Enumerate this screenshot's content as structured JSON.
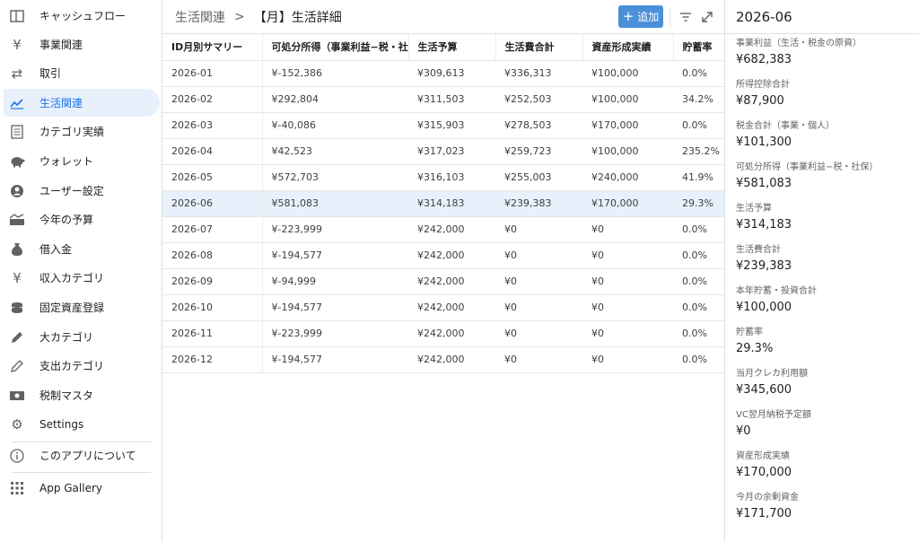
{
  "sidebar": {
    "items": [
      {
        "label": "キャッシュフロー",
        "icon": "sidebar-panel-icon"
      },
      {
        "label": "事業関連",
        "icon": "yen-icon"
      },
      {
        "label": "取引",
        "icon": "swap-icon"
      },
      {
        "label": "生活関連",
        "icon": "trending-icon",
        "active": true
      },
      {
        "label": "カテゴリ実績",
        "icon": "list-document-icon"
      },
      {
        "label": "ウォレット",
        "icon": "piggy-bank-icon"
      },
      {
        "label": "ユーザー設定",
        "icon": "account-circle-icon"
      },
      {
        "label": "今年の予算",
        "icon": "budget-icon"
      },
      {
        "label": "借入金",
        "icon": "money-bag-icon"
      },
      {
        "label": "収入カテゴリ",
        "icon": "yen-icon"
      },
      {
        "label": "固定資産登録",
        "icon": "coins-stack-icon"
      },
      {
        "label": "大カテゴリ",
        "icon": "pen-icon"
      },
      {
        "label": "支出カテゴリ",
        "icon": "pencil-outline-icon"
      },
      {
        "label": "税制マスタ",
        "icon": "banknote-icon"
      },
      {
        "label": "Settings",
        "icon": "gear-icon"
      },
      {
        "label": "このアプリについて",
        "icon": "info-icon"
      },
      {
        "label": "App Gallery",
        "icon": "grid-icon"
      }
    ]
  },
  "header": {
    "breadcrumb_parent": "生活関連",
    "breadcrumb_sep": ">",
    "title": "【月】生活詳細",
    "add_label": "追加",
    "add_icon": "plus-icon",
    "filter_icon": "filter-icon",
    "expand_icon": "expand-icon",
    "accent_color": "#4a90d9"
  },
  "table": {
    "columns": [
      "ID月別サマリー",
      "可処分所得（事業利益−税・社保）",
      "生活予算",
      "生活費合計",
      "資産形成実績",
      "貯蓄率"
    ],
    "selected_row": "2026-06",
    "rows": [
      [
        "2026-01",
        "¥-152,386",
        "¥309,613",
        "¥336,313",
        "¥100,000",
        "0.0%"
      ],
      [
        "2026-02",
        "¥292,804",
        "¥311,503",
        "¥252,503",
        "¥100,000",
        "34.2%"
      ],
      [
        "2026-03",
        "¥-40,086",
        "¥315,903",
        "¥278,503",
        "¥170,000",
        "0.0%"
      ],
      [
        "2026-04",
        "¥42,523",
        "¥317,023",
        "¥259,723",
        "¥100,000",
        "235.2%"
      ],
      [
        "2026-05",
        "¥572,703",
        "¥316,103",
        "¥255,003",
        "¥240,000",
        "41.9%"
      ],
      [
        "2026-06",
        "¥581,083",
        "¥314,183",
        "¥239,383",
        "¥170,000",
        "29.3%"
      ],
      [
        "2026-07",
        "¥-223,999",
        "¥242,000",
        "¥0",
        "¥0",
        "0.0%"
      ],
      [
        "2026-08",
        "¥-194,577",
        "¥242,000",
        "¥0",
        "¥0",
        "0.0%"
      ],
      [
        "2026-09",
        "¥-94,999",
        "¥242,000",
        "¥0",
        "¥0",
        "0.0%"
      ],
      [
        "2026-10",
        "¥-194,577",
        "¥242,000",
        "¥0",
        "¥0",
        "0.0%"
      ],
      [
        "2026-11",
        "¥-223,999",
        "¥242,000",
        "¥0",
        "¥0",
        "0.0%"
      ],
      [
        "2026-12",
        "¥-194,577",
        "¥242,000",
        "¥0",
        "¥0",
        "0.0%"
      ]
    ]
  },
  "detail": {
    "title": "2026-06",
    "fields": [
      {
        "label": "事業利益（生活・税金の原資）",
        "value": "¥682,383"
      },
      {
        "label": "所得控除合計",
        "value": "¥87,900"
      },
      {
        "label": "税金合計（事業・個人）",
        "value": "¥101,300"
      },
      {
        "label": "可処分所得（事業利益−税・社保）",
        "value": "¥581,083"
      },
      {
        "label": "生活予算",
        "value": "¥314,183"
      },
      {
        "label": "生活費合計",
        "value": "¥239,383"
      },
      {
        "label": "本年貯蓄・投資合計",
        "value": "¥100,000"
      },
      {
        "label": "貯蓄率",
        "value": "29.3%"
      },
      {
        "label": "当月クレカ利用額",
        "value": "¥345,600"
      },
      {
        "label": "VC翌月納税予定額",
        "value": "¥0"
      },
      {
        "label": "資産形成実績",
        "value": "¥170,000"
      },
      {
        "label": "今月の余剰資金",
        "value": "¥171,700"
      }
    ]
  }
}
